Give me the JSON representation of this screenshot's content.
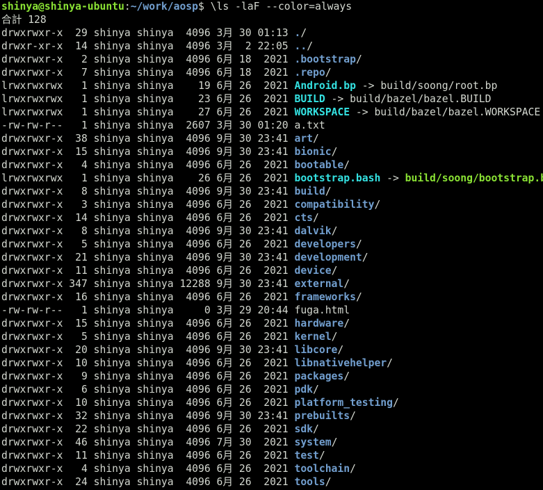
{
  "prompt": {
    "user_host": "shinya@shinya-ubuntu",
    "colon": ":",
    "path": "~/work/aosp",
    "symbol": "$",
    "command": " \\ls -laF --color=always"
  },
  "total_line": "合計 128",
  "entries": [
    {
      "perm": "drwxrwxr-x",
      "links": "29",
      "owner": "shinya",
      "group": "shinya",
      "size": "4096",
      "month": "3月",
      "day": "30",
      "time": "01:13",
      "name": ".",
      "kind": "dir",
      "suffix": "/"
    },
    {
      "perm": "drwxr-xr-x",
      "links": "14",
      "owner": "shinya",
      "group": "shinya",
      "size": "4096",
      "month": "3月",
      "day": "2",
      "time": "22:05",
      "name": "..",
      "kind": "dir",
      "suffix": "/"
    },
    {
      "perm": "drwxrwxr-x",
      "links": "2",
      "owner": "shinya",
      "group": "shinya",
      "size": "4096",
      "month": "6月",
      "day": "18",
      "time": "2021",
      "name": ".bootstrap",
      "kind": "dir",
      "suffix": "/"
    },
    {
      "perm": "drwxrwxr-x",
      "links": "7",
      "owner": "shinya",
      "group": "shinya",
      "size": "4096",
      "month": "6月",
      "day": "18",
      "time": "2021",
      "name": ".repo",
      "kind": "dir",
      "suffix": "/"
    },
    {
      "perm": "lrwxrwxrwx",
      "links": "1",
      "owner": "shinya",
      "group": "shinya",
      "size": "19",
      "month": "6月",
      "day": "26",
      "time": "2021",
      "name": "Android.bp",
      "kind": "link",
      "target": "build/soong/root.bp"
    },
    {
      "perm": "lrwxrwxrwx",
      "links": "1",
      "owner": "shinya",
      "group": "shinya",
      "size": "23",
      "month": "6月",
      "day": "26",
      "time": "2021",
      "name": "BUILD",
      "kind": "link",
      "target": "build/bazel/bazel.BUILD"
    },
    {
      "perm": "lrwxrwxrwx",
      "links": "1",
      "owner": "shinya",
      "group": "shinya",
      "size": "27",
      "month": "6月",
      "day": "26",
      "time": "2021",
      "name": "WORKSPACE",
      "kind": "link",
      "target": "build/bazel/bazel.WORKSPACE"
    },
    {
      "perm": "-rw-rw-r--",
      "links": "1",
      "owner": "shinya",
      "group": "shinya",
      "size": "2607",
      "month": "3月",
      "day": "30",
      "time": "01:20",
      "name": "a.txt",
      "kind": "file",
      "suffix": ""
    },
    {
      "perm": "drwxrwxr-x",
      "links": "38",
      "owner": "shinya",
      "group": "shinya",
      "size": "4096",
      "month": "9月",
      "day": "30",
      "time": "23:41",
      "name": "art",
      "kind": "dir",
      "suffix": "/"
    },
    {
      "perm": "drwxrwxr-x",
      "links": "15",
      "owner": "shinya",
      "group": "shinya",
      "size": "4096",
      "month": "9月",
      "day": "30",
      "time": "23:41",
      "name": "bionic",
      "kind": "dir",
      "suffix": "/"
    },
    {
      "perm": "drwxrwxr-x",
      "links": "4",
      "owner": "shinya",
      "group": "shinya",
      "size": "4096",
      "month": "6月",
      "day": "26",
      "time": "2021",
      "name": "bootable",
      "kind": "dir",
      "suffix": "/"
    },
    {
      "perm": "lrwxrwxrwx",
      "links": "1",
      "owner": "shinya",
      "group": "shinya",
      "size": "26",
      "month": "6月",
      "day": "26",
      "time": "2021",
      "name": "bootstrap.bash",
      "kind": "link-exec",
      "target": "build/soong/bootstrap.bash",
      "target_suffix": "*"
    },
    {
      "perm": "drwxrwxr-x",
      "links": "8",
      "owner": "shinya",
      "group": "shinya",
      "size": "4096",
      "month": "9月",
      "day": "30",
      "time": "23:41",
      "name": "build",
      "kind": "dir",
      "suffix": "/"
    },
    {
      "perm": "drwxrwxr-x",
      "links": "3",
      "owner": "shinya",
      "group": "shinya",
      "size": "4096",
      "month": "6月",
      "day": "26",
      "time": "2021",
      "name": "compatibility",
      "kind": "dir",
      "suffix": "/"
    },
    {
      "perm": "drwxrwxr-x",
      "links": "14",
      "owner": "shinya",
      "group": "shinya",
      "size": "4096",
      "month": "6月",
      "day": "26",
      "time": "2021",
      "name": "cts",
      "kind": "dir",
      "suffix": "/"
    },
    {
      "perm": "drwxrwxr-x",
      "links": "8",
      "owner": "shinya",
      "group": "shinya",
      "size": "4096",
      "month": "9月",
      "day": "30",
      "time": "23:41",
      "name": "dalvik",
      "kind": "dir",
      "suffix": "/"
    },
    {
      "perm": "drwxrwxr-x",
      "links": "5",
      "owner": "shinya",
      "group": "shinya",
      "size": "4096",
      "month": "6月",
      "day": "26",
      "time": "2021",
      "name": "developers",
      "kind": "dir",
      "suffix": "/"
    },
    {
      "perm": "drwxrwxr-x",
      "links": "21",
      "owner": "shinya",
      "group": "shinya",
      "size": "4096",
      "month": "9月",
      "day": "30",
      "time": "23:41",
      "name": "development",
      "kind": "dir",
      "suffix": "/"
    },
    {
      "perm": "drwxrwxr-x",
      "links": "11",
      "owner": "shinya",
      "group": "shinya",
      "size": "4096",
      "month": "6月",
      "day": "26",
      "time": "2021",
      "name": "device",
      "kind": "dir",
      "suffix": "/"
    },
    {
      "perm": "drwxrwxr-x",
      "links": "347",
      "owner": "shinya",
      "group": "shinya",
      "size": "12288",
      "month": "9月",
      "day": "30",
      "time": "23:41",
      "name": "external",
      "kind": "dir",
      "suffix": "/"
    },
    {
      "perm": "drwxrwxr-x",
      "links": "16",
      "owner": "shinya",
      "group": "shinya",
      "size": "4096",
      "month": "6月",
      "day": "26",
      "time": "2021",
      "name": "frameworks",
      "kind": "dir",
      "suffix": "/"
    },
    {
      "perm": "-rw-rw-r--",
      "links": "1",
      "owner": "shinya",
      "group": "shinya",
      "size": "0",
      "month": "3月",
      "day": "29",
      "time": "20:44",
      "name": "fuga.html",
      "kind": "file",
      "suffix": ""
    },
    {
      "perm": "drwxrwxr-x",
      "links": "15",
      "owner": "shinya",
      "group": "shinya",
      "size": "4096",
      "month": "6月",
      "day": "26",
      "time": "2021",
      "name": "hardware",
      "kind": "dir",
      "suffix": "/"
    },
    {
      "perm": "drwxrwxr-x",
      "links": "5",
      "owner": "shinya",
      "group": "shinya",
      "size": "4096",
      "month": "6月",
      "day": "26",
      "time": "2021",
      "name": "kernel",
      "kind": "dir",
      "suffix": "/"
    },
    {
      "perm": "drwxrwxr-x",
      "links": "20",
      "owner": "shinya",
      "group": "shinya",
      "size": "4096",
      "month": "9月",
      "day": "30",
      "time": "23:41",
      "name": "libcore",
      "kind": "dir",
      "suffix": "/"
    },
    {
      "perm": "drwxrwxr-x",
      "links": "10",
      "owner": "shinya",
      "group": "shinya",
      "size": "4096",
      "month": "6月",
      "day": "26",
      "time": "2021",
      "name": "libnativehelper",
      "kind": "dir",
      "suffix": "/"
    },
    {
      "perm": "drwxrwxr-x",
      "links": "9",
      "owner": "shinya",
      "group": "shinya",
      "size": "4096",
      "month": "6月",
      "day": "26",
      "time": "2021",
      "name": "packages",
      "kind": "dir",
      "suffix": "/"
    },
    {
      "perm": "drwxrwxr-x",
      "links": "6",
      "owner": "shinya",
      "group": "shinya",
      "size": "4096",
      "month": "6月",
      "day": "26",
      "time": "2021",
      "name": "pdk",
      "kind": "dir",
      "suffix": "/"
    },
    {
      "perm": "drwxrwxr-x",
      "links": "10",
      "owner": "shinya",
      "group": "shinya",
      "size": "4096",
      "month": "6月",
      "day": "26",
      "time": "2021",
      "name": "platform_testing",
      "kind": "dir",
      "suffix": "/"
    },
    {
      "perm": "drwxrwxr-x",
      "links": "32",
      "owner": "shinya",
      "group": "shinya",
      "size": "4096",
      "month": "9月",
      "day": "30",
      "time": "23:41",
      "name": "prebuilts",
      "kind": "dir",
      "suffix": "/"
    },
    {
      "perm": "drwxrwxr-x",
      "links": "22",
      "owner": "shinya",
      "group": "shinya",
      "size": "4096",
      "month": "6月",
      "day": "26",
      "time": "2021",
      "name": "sdk",
      "kind": "dir",
      "suffix": "/"
    },
    {
      "perm": "drwxrwxr-x",
      "links": "46",
      "owner": "shinya",
      "group": "shinya",
      "size": "4096",
      "month": "7月",
      "day": "30",
      "time": "2021",
      "name": "system",
      "kind": "dir",
      "suffix": "/"
    },
    {
      "perm": "drwxrwxr-x",
      "links": "11",
      "owner": "shinya",
      "group": "shinya",
      "size": "4096",
      "month": "6月",
      "day": "26",
      "time": "2021",
      "name": "test",
      "kind": "dir",
      "suffix": "/"
    },
    {
      "perm": "drwxrwxr-x",
      "links": "4",
      "owner": "shinya",
      "group": "shinya",
      "size": "4096",
      "month": "6月",
      "day": "26",
      "time": "2021",
      "name": "toolchain",
      "kind": "dir",
      "suffix": "/"
    },
    {
      "perm": "drwxrwxr-x",
      "links": "24",
      "owner": "shinya",
      "group": "shinya",
      "size": "4096",
      "month": "6月",
      "day": "26",
      "time": "2021",
      "name": "tools",
      "kind": "dir",
      "suffix": "/"
    }
  ],
  "link_arrow": " -> ",
  "colors": {
    "background": "#000000",
    "foreground": "#d3d7cf",
    "directory": "#729fcf",
    "symlink": "#34e2e2",
    "executable": "#8ae234",
    "prompt_user": "#8ae234",
    "prompt_path": "#729fcf"
  }
}
